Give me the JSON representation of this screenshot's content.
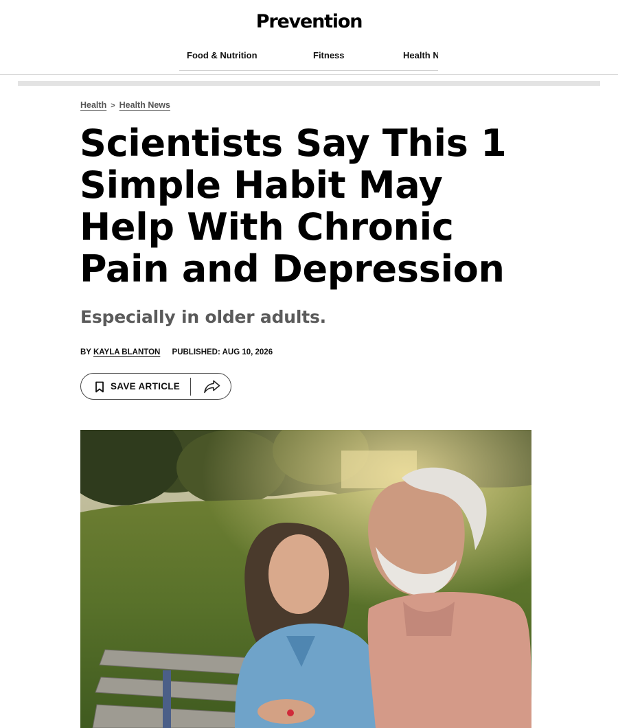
{
  "site": {
    "logo": "Prevention"
  },
  "nav": {
    "items": [
      "Food & Nutrition",
      "Fitness",
      "Health N"
    ]
  },
  "breadcrumb": {
    "items": [
      "Health",
      "Health News"
    ],
    "separator": ">"
  },
  "article": {
    "headline": "Scientists Say This 1 Simple Habit May Help With Chronic Pain and Depression",
    "dek": "Especially in older adults.",
    "byline_prefix": "BY",
    "author": "KAYLA BLANTON",
    "published": "PUBLISHED: AUG 10, 2026"
  },
  "actions": {
    "save_label": "SAVE ARTICLE",
    "save_icon": "bookmark-icon",
    "share_icon": "share-icon"
  },
  "colors": {
    "text": "#000000",
    "dek": "#5a5a5a",
    "breadcrumb": "#555555",
    "divider": "#d9d9d9"
  }
}
